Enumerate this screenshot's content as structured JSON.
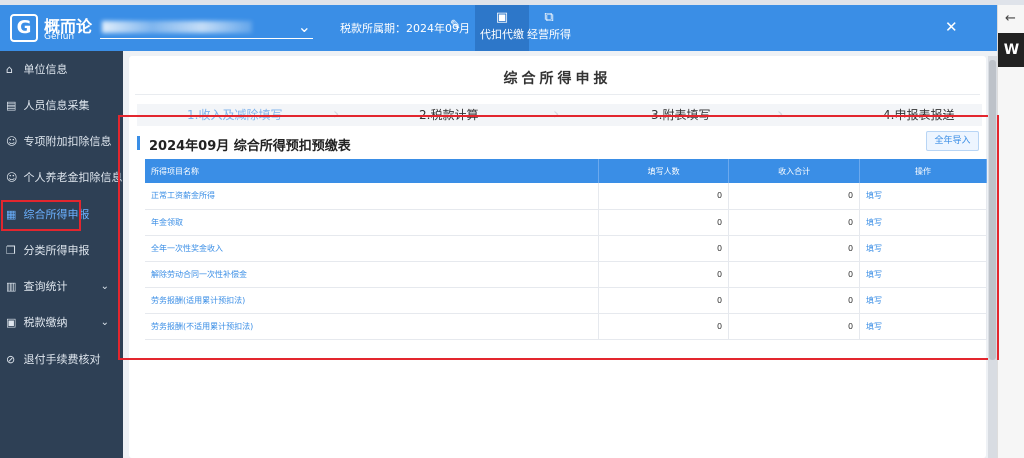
{
  "header": {
    "logo_mark": "G",
    "brand_name": "概而论",
    "brand_sub": "Gerlun",
    "tax_period": "税款所属期：2024年09月",
    "nav": [
      {
        "label": "代扣代缴",
        "icon": "briefcase-icon"
      },
      {
        "label": "经营所得",
        "icon": "chart-icon"
      }
    ],
    "fullscreen_icon": "✕"
  },
  "sidebar": {
    "items": [
      {
        "label": "单位信息",
        "icon": "home-icon"
      },
      {
        "label": "人员信息采集",
        "icon": "id-card-icon"
      },
      {
        "label": "专项附加扣除信息",
        "icon": "user-icon"
      },
      {
        "label": "个人养老金扣除信息采集",
        "icon": "user-icon"
      },
      {
        "label": "综合所得申报",
        "icon": "document-icon"
      },
      {
        "label": "分类所得申报",
        "icon": "copy-icon"
      },
      {
        "label": "查询统计",
        "icon": "chart-icon"
      },
      {
        "label": "税款缴纳",
        "icon": "wallet-icon"
      },
      {
        "label": "退付手续费核对",
        "icon": "refund-icon"
      }
    ]
  },
  "main": {
    "page_title": "综合所得申报",
    "steps": [
      {
        "label": "1.收入及减除填写"
      },
      {
        "label": "2.税款计算"
      },
      {
        "label": "3.附表填写"
      },
      {
        "label": "4.申报表报送"
      }
    ],
    "panel": {
      "title": "2024年09月 综合所得预扣预缴表",
      "import_button": "全年导入",
      "columns": [
        "所得项目名称",
        "填写人数",
        "收入合计",
        "操作"
      ],
      "rows": [
        {
          "name": "正常工资薪金所得",
          "count": "0",
          "income": "0",
          "action": "填写"
        },
        {
          "name": "年金领取",
          "count": "0",
          "income": "0",
          "action": "填写"
        },
        {
          "name": "全年一次性奖金收入",
          "count": "0",
          "income": "0",
          "action": "填写"
        },
        {
          "name": "解除劳动合同一次性补偿金",
          "count": "0",
          "income": "0",
          "action": "填写"
        },
        {
          "name": "劳务报酬(适用累计预扣法)",
          "count": "0",
          "income": "0",
          "action": "填写"
        },
        {
          "name": "劳务报酬(不适用累计预扣法)",
          "count": "0",
          "income": "0",
          "action": "填写"
        }
      ]
    }
  },
  "colors": {
    "brand_blue": "#3a8ee6",
    "sidebar_bg": "#2e4055",
    "highlight_red": "#e3262e"
  }
}
